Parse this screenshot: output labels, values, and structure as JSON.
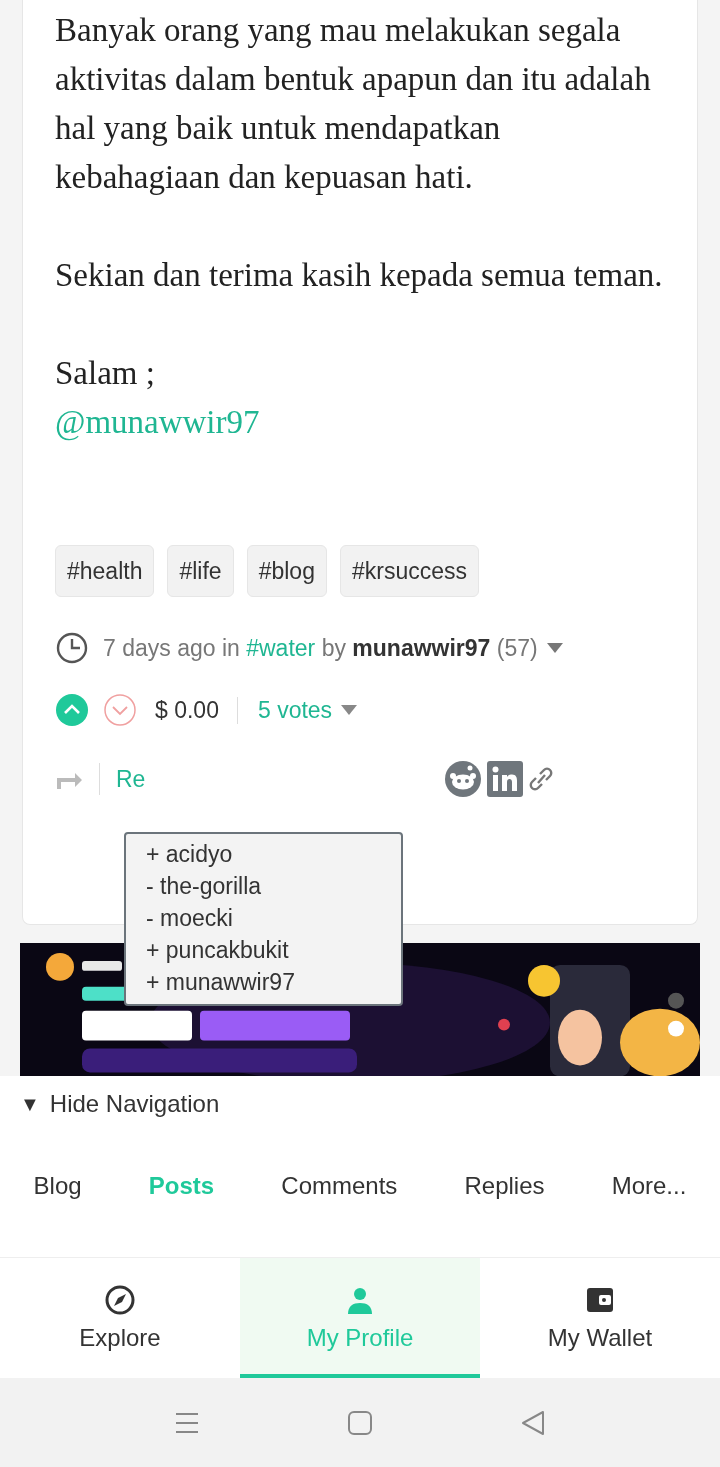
{
  "post": {
    "paragraphs": [
      "Banyak orang yang mau melakukan segala aktivitas dalam bentuk apapun dan itu adalah hal yang baik untuk mendapatkan kebahagiaan dan kepuasan hati.",
      "Sekian dan terima kasih kepada semua teman."
    ],
    "greeting": "Salam ;",
    "mention": "@munawwir97"
  },
  "tags": [
    "#health",
    "#life",
    "#blog",
    "#krsuccess"
  ],
  "meta": {
    "time": "7 days ago",
    "in_word": "in",
    "category": "#water",
    "by_word": "by",
    "author": "munawwir97",
    "reputation": "(57)"
  },
  "votes": {
    "upvoted": true,
    "downvoted": false,
    "payout": "$ 0.00",
    "votes_label": "5 votes"
  },
  "actions": {
    "reblog": "Re"
  },
  "voters_popup": [
    "+ acidyo",
    "- the-gorilla",
    "- moecki",
    "+ puncakbukit",
    "+ munawwir97"
  ],
  "banner": {
    "kind": "picture"
  },
  "navigation": {
    "toggle_icon": "▼",
    "label": "Hide Navigation"
  },
  "nav_tabs": [
    {
      "label": "Blog",
      "selected": false
    },
    {
      "label": "Posts",
      "selected": true
    },
    {
      "label": "Comments",
      "selected": false
    },
    {
      "label": "Replies",
      "selected": false
    },
    {
      "label": "More...",
      "selected": false
    }
  ],
  "bottom_tabs": [
    {
      "kind": "explore",
      "label": "Explore",
      "selected": false
    },
    {
      "kind": "profile",
      "label": "My Profile",
      "selected": true
    },
    {
      "kind": "wallet",
      "label": "My Wallet",
      "selected": false
    }
  ]
}
